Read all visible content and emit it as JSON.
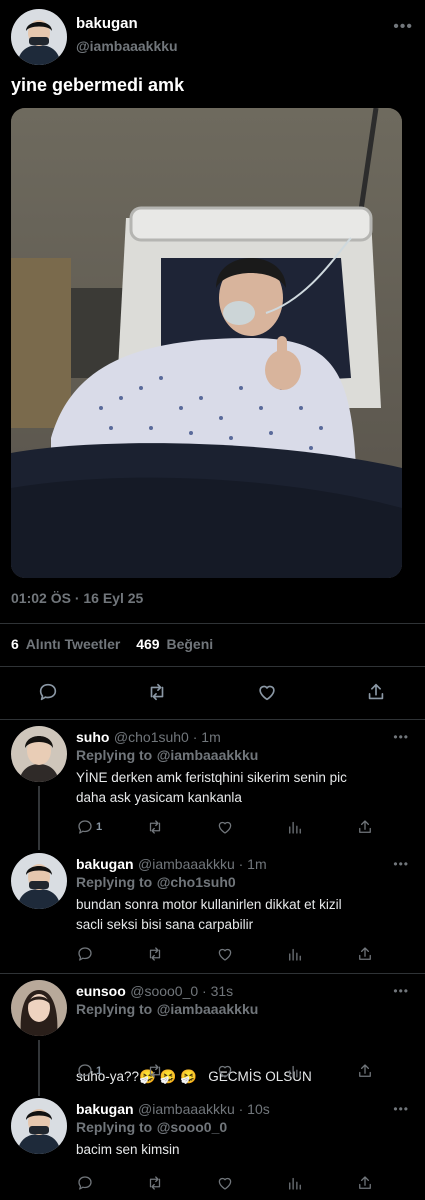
{
  "main_tweet": {
    "display_name": "bakugan",
    "handle": "@iambaaakkku",
    "text": "yine gebermedi amk",
    "timestamp": "01:02 ÖS · 16 Eyl 25",
    "quote_count": "6",
    "quote_label": "Alıntı Tweetler",
    "like_count": "469",
    "like_label": "Beğeni",
    "photo_icon": "hospital-photo"
  },
  "replies": [
    {
      "display_name": "suho",
      "handle": "@cho1suh0 · 1m",
      "replying_label": "Replying to",
      "replying_to": "@iambaaakkku",
      "text_line1": "YİNE derken amk feristqhini sikerim senin pic",
      "text_line2": "daha ask yasicam kankanla",
      "reply_count": "1"
    },
    {
      "display_name": "bakugan",
      "handle": "@iambaaakkku · 1m",
      "replying_label": "Replying to",
      "replying_to": "@cho1suh0",
      "text_line1": "bundan sonra motor kullanirlen dikkat et kizil",
      "text_line2": "sacli seksi bisi sana carpabilir",
      "reply_count": ""
    },
    {
      "display_name": "eunsoo",
      "handle": "@sooo0_0 · 31s",
      "replying_label": "Replying to",
      "replying_to": "@iambaaakkku",
      "text_line1": "suho-ya??🤧 🤧 🤧   GECMİS OLSUN",
      "text_line2": "",
      "reply_count": "1"
    },
    {
      "display_name": "bakugan",
      "handle": "@iambaaakkku · 10s",
      "replying_label": "Replying to",
      "replying_to": "@sooo0_0",
      "text_line1": "bacim sen kimsin",
      "text_line2": "",
      "reply_count": ""
    }
  ],
  "colors": {
    "background": "#000000",
    "accent": "#1d9bf0",
    "muted": "#71767b",
    "divider": "#2f3336"
  }
}
